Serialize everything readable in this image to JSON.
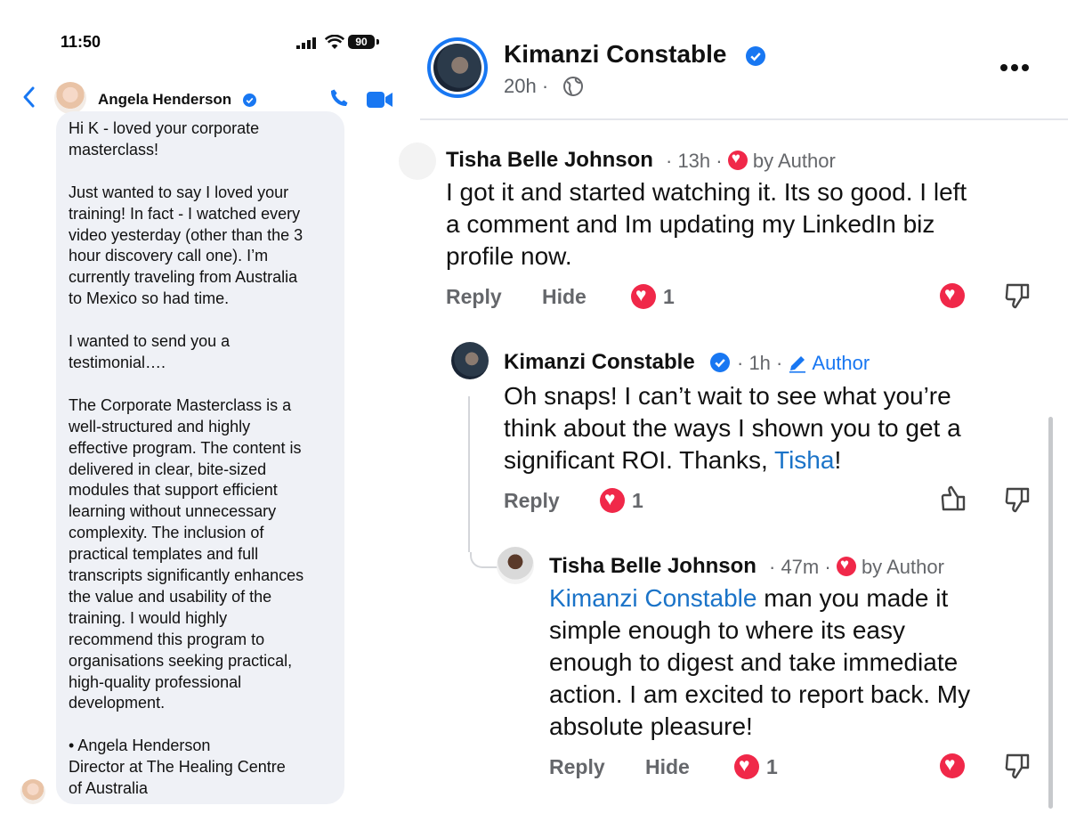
{
  "messenger": {
    "time": "11:50",
    "battery": "90",
    "contact_name": "Angela Henderson",
    "message": "Hi K - loved your corporate\nmasterclass!\n\nJust wanted to say I loved your\ntraining! In fact - I watched every\nvideo yesterday (other than the 3\nhour discovery call one). I’m\ncurrently traveling from Australia\nto Mexico so had time.\n\nI wanted to send you a\ntestimonial….\n\nThe Corporate Masterclass is a\nwell-structured and highly\neffective program. The content is\ndelivered in clear, bite-sized\nmodules that support efficient\nlearning without unnecessary\ncomplexity. The inclusion of\npractical templates and full\ntranscripts significantly enhances\nthe value and usability of the\ntraining. I would highly\nrecommend this program to\norganisations seeking practical,\nhigh-quality professional\ndevelopment.\n\n    •  Angela Henderson\nDirector at The Healing Centre\nof Australia"
  },
  "post": {
    "author": "Kimanzi Constable",
    "time": "20h",
    "separator": "·"
  },
  "comments": [
    {
      "name": "Tisha Belle Johnson",
      "time": "· 13h ·",
      "badge": "by Author",
      "text_lines": [
        "I got it and started watching it. Its so good. I left",
        "a comment and Im updating my LinkedIn biz",
        "profile now."
      ],
      "reply": "Reply",
      "hide": "Hide",
      "reaction_count": "1"
    },
    {
      "name": "Kimanzi Constable",
      "time": "· 1h ·",
      "badge": "Author",
      "text_lines": [
        "Oh snaps! I can’t wait to see what you’re",
        "think about the ways I shown you to get a",
        "significant ROI. Thanks, "
      ],
      "mention": "Tisha",
      "text_end": "!",
      "reply": "Reply",
      "reaction_count": "1"
    },
    {
      "name": "Tisha Belle Johnson",
      "time": "· 47m ·",
      "badge": "by Author",
      "mention": "Kimanzi Constable",
      "text_first": " man you made it",
      "text_lines": [
        "simple enough to where its easy",
        "enough to digest and take immediate",
        "action. I am excited to report back. My",
        "absolute pleasure!"
      ],
      "reply": "Reply",
      "hide": "Hide",
      "reaction_count": "1"
    }
  ],
  "colors": {
    "accent_blue": "#1877f2",
    "heart_red": "#f02849",
    "mention_blue": "#1a73c8",
    "bubble_gray": "#eff1f6"
  }
}
